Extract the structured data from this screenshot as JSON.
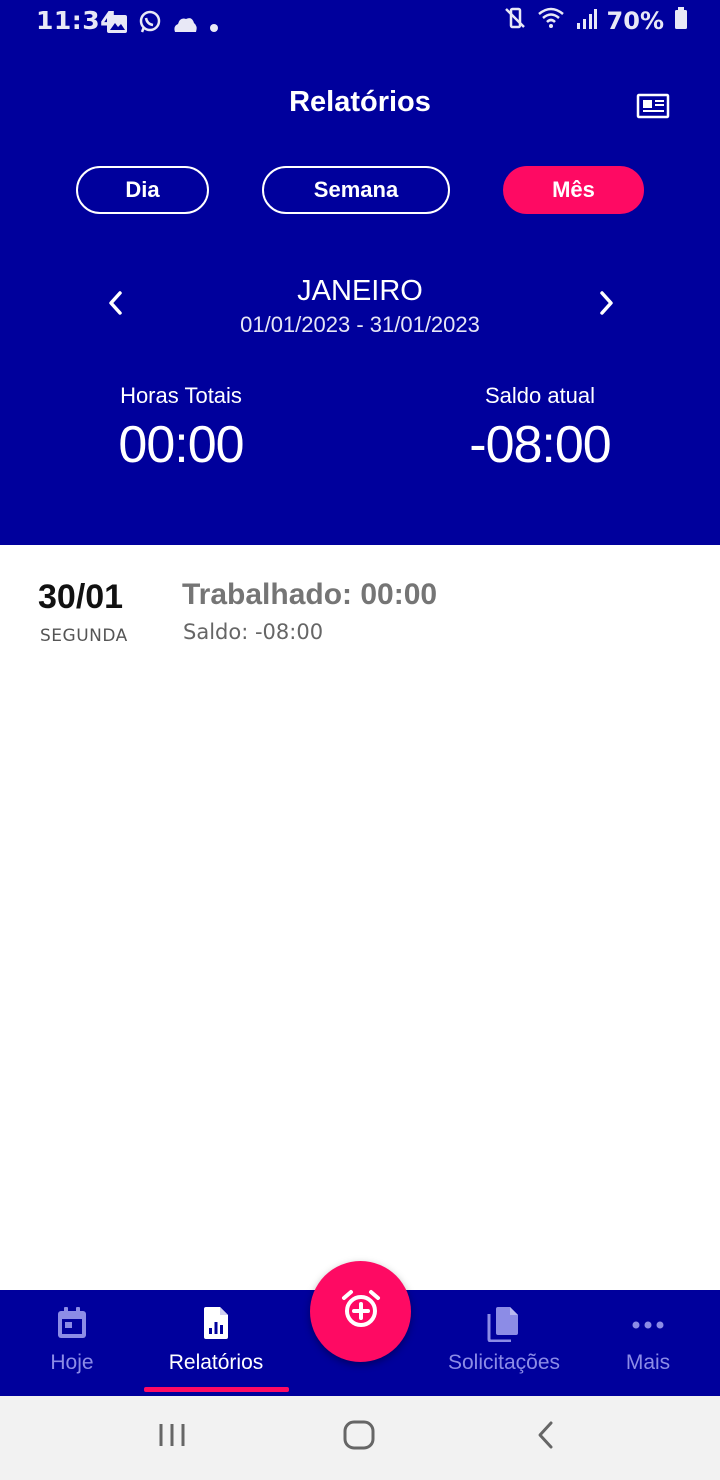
{
  "status_bar": {
    "time": "11:34",
    "left_icons": [
      "image-icon",
      "whatsapp-icon",
      "cloud-icon",
      "dot-icon"
    ],
    "right_icons": [
      "mute-vibrate-icon",
      "wifi-icon",
      "signal-icon",
      "battery-icon"
    ],
    "battery": "70%"
  },
  "header": {
    "title": "Relatórios",
    "report_icon": "newspaper-icon"
  },
  "period_tabs": [
    {
      "label": "Dia",
      "active": false
    },
    {
      "label": "Semana",
      "active": false
    },
    {
      "label": "Mês",
      "active": true
    }
  ],
  "period": {
    "name": "JANEIRO",
    "range": "01/01/2023 - 31/01/2023",
    "prev_icon": "chevron-left-icon",
    "next_icon": "chevron-right-icon"
  },
  "stats": {
    "total_hours_label": "Horas Totais",
    "total_hours_value": "00:00",
    "balance_label": "Saldo atual",
    "balance_value": "-08:00"
  },
  "days": [
    {
      "date": "30/01",
      "weekday": "SEGUNDA",
      "worked": "Trabalhado: 00:00",
      "balance": "Saldo: -08:00"
    }
  ],
  "fab": {
    "icon": "alarm-add-icon"
  },
  "bottom_nav": [
    {
      "label": "Hoje",
      "icon": "calendar-icon",
      "active": false
    },
    {
      "label": "Relatórios",
      "icon": "report-file-icon",
      "active": true
    },
    {
      "label": "Solicitações",
      "icon": "documents-icon",
      "active": false
    },
    {
      "label": "Mais",
      "icon": "more-dots-icon",
      "active": false
    }
  ],
  "colors": {
    "primary": "#00009c",
    "accent": "#fe0a63",
    "inactive_nav": "#8c8ce6",
    "worked_text": "#757575"
  }
}
